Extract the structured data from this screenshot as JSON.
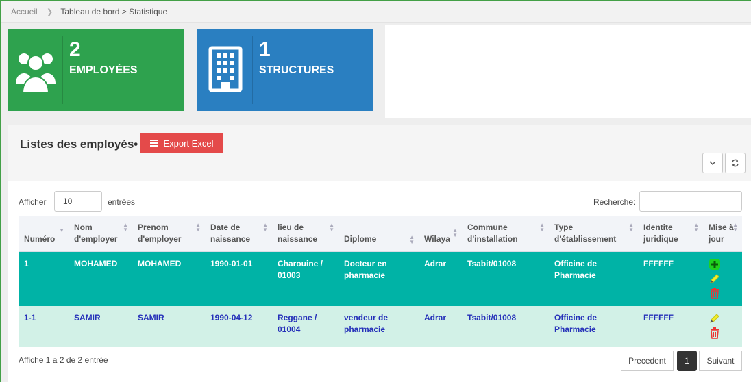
{
  "breadcrumb": {
    "home": "Accueil",
    "path": "Tableau de bord > Statistique"
  },
  "stats": [
    {
      "value": "2",
      "label": "EMPLOYÉES",
      "color": "#2ea24e",
      "icon": "users-icon"
    },
    {
      "value": "1",
      "label": "STRUCTURES",
      "color": "#2a7fc1",
      "icon": "building-icon"
    }
  ],
  "panel": {
    "title": "Listes des employés•",
    "export_label": "Export Excel"
  },
  "controls": {
    "show_label": "Afficher",
    "show_value": "10",
    "entries_label": "entrées",
    "search_label": "Recherche:",
    "search_value": ""
  },
  "table": {
    "headers": [
      "Numéro",
      "Nom d'employer",
      "Prenom d'employer",
      "Date de naissance",
      "lieu de naissance",
      "Diplome",
      "Wilaya",
      "Commune d'installation",
      "Type d'établissement",
      "Identite juridique",
      "Mise à jour"
    ],
    "rows": [
      {
        "numero": "1",
        "nom": "MOHAMED",
        "prenom": "MOHAMED",
        "date": "1990-01-01",
        "lieu": "Charouine / 01003",
        "diplome": "Docteur en pharmacie",
        "wilaya": "Adrar",
        "commune": "Tsabit/01008",
        "type": "Officine de Pharmacie",
        "identite": "FFFFFF"
      },
      {
        "numero": "1-1",
        "nom": "SAMIR",
        "prenom": "SAMIR",
        "date": "1990-04-12",
        "lieu": "Reggane / 01004",
        "diplome": "vendeur de pharmacie",
        "wilaya": "Adrar",
        "commune": "Tsabit/01008",
        "type": "Officine de Pharmacie",
        "identite": "FFFFFF"
      }
    ]
  },
  "footer": {
    "info": "Affiche 1 a 2 de 2 entrée",
    "prev": "Precedent",
    "page": "1",
    "next": "Suivant"
  },
  "colors": {
    "row_selected": "#00b3a6",
    "row_normal": "#d2f1e7",
    "export_button": "#e44a4a"
  }
}
